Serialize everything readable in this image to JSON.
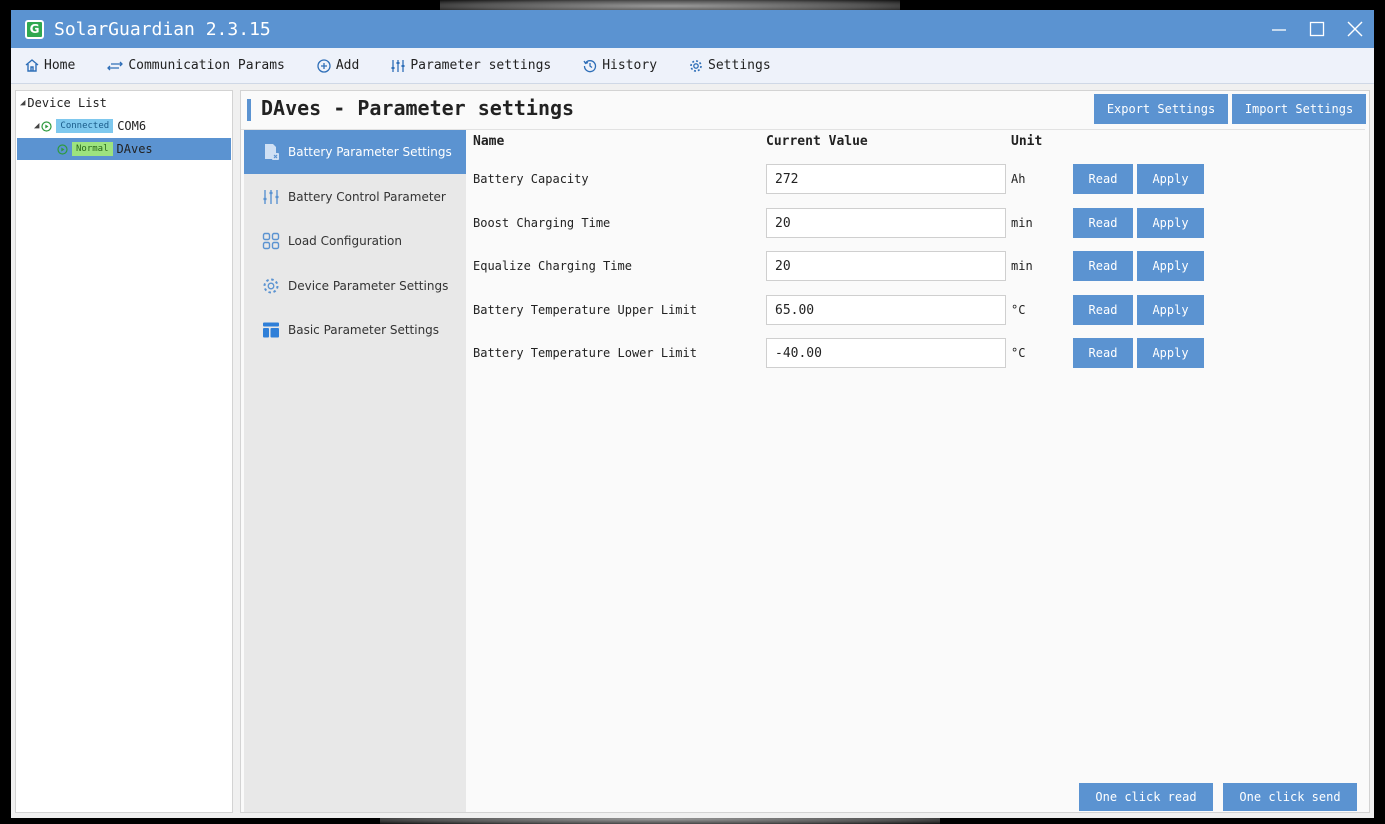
{
  "window": {
    "title": "SolarGuardian 2.3.15",
    "logo_letter": "G",
    "brand_color": "#5b93d1"
  },
  "menu": [
    {
      "label": "Home",
      "icon": "home-icon"
    },
    {
      "label": "Communication Params",
      "icon": "swap-arrows-icon"
    },
    {
      "label": "Add",
      "icon": "plus-circle-icon"
    },
    {
      "label": "Parameter settings",
      "icon": "sliders-icon"
    },
    {
      "label": "History",
      "icon": "history-icon"
    },
    {
      "label": "Settings",
      "icon": "gear-icon"
    }
  ],
  "device_tree": {
    "root": "Device List",
    "port": {
      "badge": "Connected",
      "name": "COM6"
    },
    "device": {
      "badge": "Normal",
      "name": "DAves"
    }
  },
  "page": {
    "title": "DAves - Parameter settings",
    "export_label": "Export Settings",
    "import_label": "Import Settings"
  },
  "side_nav": [
    {
      "label": "Battery Parameter Settings",
      "icon": "battery-doc-icon",
      "active": true
    },
    {
      "label": "Battery Control Parameter",
      "icon": "sliders-icon",
      "active": false
    },
    {
      "label": "Load Configuration",
      "icon": "grid-icon",
      "active": false
    },
    {
      "label": "Device Parameter Settings",
      "icon": "gear-icon",
      "active": false
    },
    {
      "label": "Basic Parameter Settings",
      "icon": "layout-icon",
      "active": false
    }
  ],
  "table": {
    "headers": {
      "name": "Name",
      "value": "Current Value",
      "unit": "Unit"
    },
    "rows": [
      {
        "name": "Battery Capacity",
        "value": "272",
        "unit": "Ah",
        "read": "Read",
        "apply": "Apply"
      },
      {
        "name": "Boost Charging Time",
        "value": "20",
        "unit": "min",
        "read": "Read",
        "apply": "Apply"
      },
      {
        "name": "Equalize Charging Time",
        "value": "20",
        "unit": "min",
        "read": "Read",
        "apply": "Apply"
      },
      {
        "name": "Battery Temperature Upper Limit",
        "value": "65.00",
        "unit": "°C",
        "read": "Read",
        "apply": "Apply"
      },
      {
        "name": "Battery Temperature Lower Limit",
        "value": "-40.00",
        "unit": "°C",
        "read": "Read",
        "apply": "Apply"
      }
    ]
  },
  "footer": {
    "one_click_read": "One click read",
    "one_click_send": "One click send"
  }
}
